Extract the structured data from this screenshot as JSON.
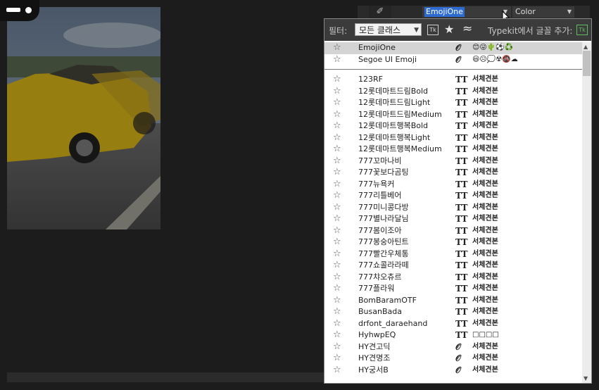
{
  "options": {
    "font_value": "EmojiOne",
    "style_value": "Color"
  },
  "filter": {
    "label": "필터:",
    "class_value": "모든 클래스",
    "typekit_label": "Typekit에서 글꼴 추가:",
    "tk": "Tk"
  },
  "fonts_top": [
    {
      "name": "EmojiOne",
      "type_icon": "𝒪",
      "sample": "😊😜🌵⚽♻️"
    },
    {
      "name": "Segoe UI Emoji",
      "type_icon": "𝒪",
      "sample": "😃☹💭☢🚳☁"
    }
  ],
  "fonts": [
    {
      "name": "123RF",
      "type_icon": "TT",
      "sample": "서체견본"
    },
    {
      "name": "12롯데마트드림Bold",
      "type_icon": "TT",
      "sample": "서체견본"
    },
    {
      "name": "12롯데마트드림Light",
      "type_icon": "TT",
      "sample": "서체견본"
    },
    {
      "name": "12롯데마트드림Medium",
      "type_icon": "TT",
      "sample": "서체견본"
    },
    {
      "name": "12롯데마트행복Bold",
      "type_icon": "TT",
      "sample": "서체견본"
    },
    {
      "name": "12롯데마트행복Light",
      "type_icon": "TT",
      "sample": "서체견본"
    },
    {
      "name": "12롯데마트행복Medium",
      "type_icon": "TT",
      "sample": "서체견본"
    },
    {
      "name": "777꼬마나비",
      "type_icon": "TT",
      "sample": "서체견본"
    },
    {
      "name": "777꽃보다곰팅",
      "type_icon": "TT",
      "sample": "서체견본"
    },
    {
      "name": "777뉴욕커",
      "type_icon": "TT",
      "sample": "서체견본"
    },
    {
      "name": "777리틀베어",
      "type_icon": "TT",
      "sample": "서체견본"
    },
    {
      "name": "777미니콩다방",
      "type_icon": "TT",
      "sample": "서체견본"
    },
    {
      "name": "777별나라달님",
      "type_icon": "TT",
      "sample": "서체견본"
    },
    {
      "name": "777봄이조아",
      "type_icon": "TT",
      "sample": "서체견본"
    },
    {
      "name": "777봉숭아틴트",
      "type_icon": "TT",
      "sample": "서체견본"
    },
    {
      "name": "777빨간우체통",
      "type_icon": "TT",
      "sample": "서체견본"
    },
    {
      "name": "777쇼콜라라떼",
      "type_icon": "TT",
      "sample": "서체견본"
    },
    {
      "name": "777챠오츄르",
      "type_icon": "TT",
      "sample": "서체견본"
    },
    {
      "name": "777플라워",
      "type_icon": "TT",
      "sample": "서체견본"
    },
    {
      "name": "BomBaramOTF",
      "type_icon": "TT",
      "sample": "서체견본"
    },
    {
      "name": "BusanBada",
      "type_icon": "TT",
      "sample": "서체견본"
    },
    {
      "name": "drfont_daraehand",
      "type_icon": "TT",
      "sample": "서체견본"
    },
    {
      "name": "HyhwpEQ",
      "type_icon": "TT",
      "sample": "□□□□"
    },
    {
      "name": "HY견고딕",
      "type_icon": "𝒪",
      "sample": "서체견본"
    },
    {
      "name": "HY견명조",
      "type_icon": "𝒪",
      "sample": "서체견본"
    },
    {
      "name": "HY궁서B",
      "type_icon": "𝒪",
      "sample": "서체견본"
    }
  ]
}
